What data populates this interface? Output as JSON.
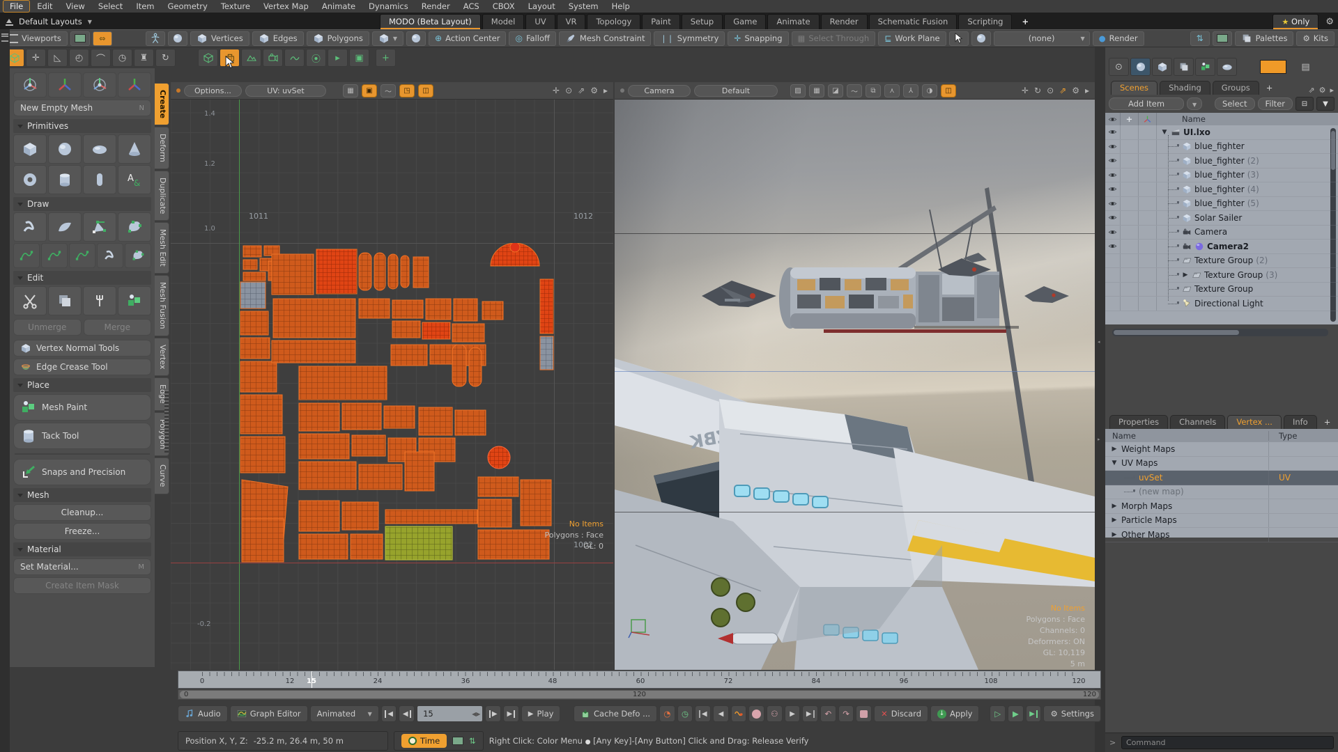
{
  "menubar": {
    "items": [
      "File",
      "Edit",
      "View",
      "Select",
      "Item",
      "Geometry",
      "Texture",
      "Vertex Map",
      "Animate",
      "Dynamics",
      "Render",
      "ACS",
      "CBOX",
      "Layout",
      "System",
      "Help"
    ]
  },
  "layout_bar": {
    "default_layouts": "Default Layouts",
    "tabs": [
      "MODO (Beta Layout)",
      "Model",
      "UV",
      "VR",
      "Topology",
      "Paint",
      "Setup",
      "Game",
      "Animate",
      "Render",
      "Schematic Fusion",
      "Scripting",
      "+"
    ],
    "only": "Only"
  },
  "toolbar": {
    "viewports": "Viewports",
    "vertices": "Vertices",
    "edges": "Edges",
    "polygons": "Polygons",
    "action_center": "Action Center",
    "falloff": "Falloff",
    "mesh_constraint": "Mesh Constraint",
    "symmetry": "Symmetry",
    "snapping": "Snapping",
    "select_through": "Select Through",
    "work_plane": "Work Plane",
    "preset": "(none)",
    "render": "Render",
    "palettes": "Palettes",
    "kits": "Kits"
  },
  "sidebar": {
    "new_empty_mesh": "New Empty Mesh",
    "key_n": "N",
    "sections": {
      "primitives": "Primitives",
      "draw": "Draw",
      "edit": "Edit",
      "place": "Place",
      "mesh": "Mesh",
      "material": "Material"
    },
    "unmerge": "Unmerge",
    "merge": "Merge",
    "vertex_normal_tools": "Vertex Normal Tools",
    "edge_crease_tool": "Edge Crease Tool",
    "mesh_paint": "Mesh Paint",
    "tack_tool": "Tack Tool",
    "snaps": "Snaps and Precision",
    "cleanup": "Cleanup...",
    "freeze": "Freeze...",
    "set_material": "Set Material...",
    "key_m": "M",
    "create_item_mask": "Create Item Mask",
    "tabs": [
      "Create",
      "Deform",
      "Duplicate",
      "Mesh Edit",
      "Mesh Fusion",
      "Vertex",
      "Edge",
      "Polygon",
      "Curve"
    ]
  },
  "uv": {
    "options": "Options...",
    "map_label": "UV: uvSet",
    "axis": [
      "1.4",
      "1.2",
      "1.0",
      "-0.2"
    ],
    "udim": [
      "1011",
      "1012",
      "1001",
      "1002"
    ],
    "overlay": {
      "no_items": "No Items",
      "selection": "Polygons : Face",
      "gl": "GL: 0"
    }
  },
  "v3d": {
    "camera": "Camera",
    "style": "Default",
    "wing_text": "DZBK",
    "overlay": {
      "no_items": "No Items",
      "selection": "Polygons : Face",
      "channels": "Channels: 0",
      "deformers": "Deformers: ON",
      "gl": "GL: 10,119",
      "scale": "5 m"
    }
  },
  "scene": {
    "tabs": [
      "Scenes",
      "Shading",
      "Groups",
      "+"
    ],
    "add_item": "Add Item",
    "select": "Select",
    "filter": "Filter",
    "name_col": "Name",
    "items": [
      {
        "name": "UI.lxo",
        "suffix": ""
      },
      {
        "name": "blue_fighter",
        "suffix": ""
      },
      {
        "name": "blue_fighter",
        "suffix": "(2)"
      },
      {
        "name": "blue_fighter",
        "suffix": "(3)"
      },
      {
        "name": "blue_fighter",
        "suffix": "(4)"
      },
      {
        "name": "blue_fighter",
        "suffix": "(5)"
      },
      {
        "name": "Solar Sailer",
        "suffix": ""
      },
      {
        "name": "Camera",
        "suffix": ""
      },
      {
        "name": "Camera2",
        "suffix": ""
      },
      {
        "name": "Texture Group",
        "suffix": "(2)"
      },
      {
        "name": "Texture Group",
        "suffix": "(3)"
      },
      {
        "name": "Texture Group",
        "suffix": ""
      },
      {
        "name": "Directional Light",
        "suffix": ""
      }
    ]
  },
  "vmaps": {
    "tabs": [
      "Properties",
      "Channels",
      "Vertex ...",
      "Info",
      "+"
    ],
    "name_col": "Name",
    "type_col": "Type",
    "rows": [
      {
        "name": "Weight Maps",
        "type": ""
      },
      {
        "name": "UV Maps",
        "type": ""
      },
      {
        "name": "uvSet",
        "type": "UV"
      },
      {
        "name": "(new map)",
        "type": ""
      },
      {
        "name": "Morph Maps",
        "type": ""
      },
      {
        "name": "Particle Maps",
        "type": ""
      },
      {
        "name": "Other Maps",
        "type": ""
      }
    ]
  },
  "timeline": {
    "ticks": [
      "0",
      "12",
      "24",
      "36",
      "48",
      "60",
      "72",
      "84",
      "96",
      "108",
      "120"
    ],
    "current": "15",
    "range_start": "0",
    "range_mid": "120",
    "range_end": "120"
  },
  "transport": {
    "audio": "Audio",
    "graph_editor": "Graph Editor",
    "animated": "Animated",
    "frame": "15",
    "play": "Play",
    "cache_defo": "Cache Defo ...",
    "discard": "Discard",
    "apply": "Apply",
    "settings": "Settings"
  },
  "status": {
    "position_label": "Position X, Y, Z:",
    "position_value": "-25.2 m, 26.4 m, 50 m",
    "time": "Time",
    "hint1": "Right Click: Color Menu",
    "hint2": "[Any Key]-[Any Button] Click and Drag: Release Verify"
  },
  "command": {
    "placeholder": "Command"
  }
}
